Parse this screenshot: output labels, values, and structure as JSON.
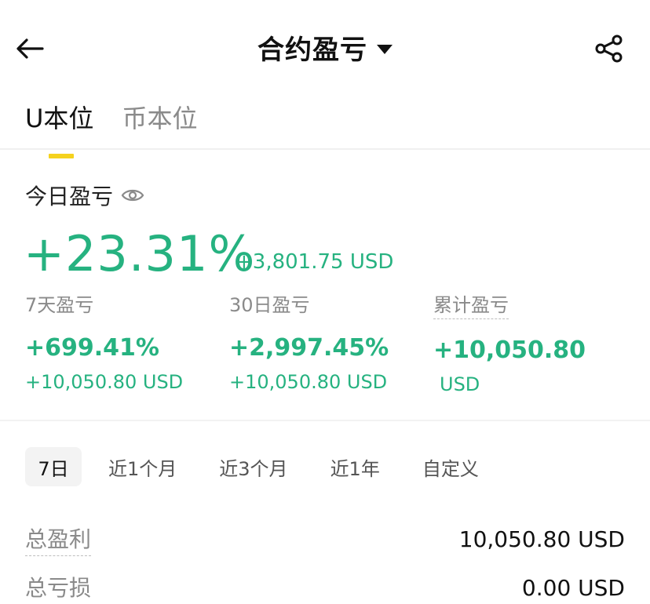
{
  "header": {
    "title": "合约盈亏",
    "back_icon": "arrow-left-icon",
    "dropdown_icon": "caret-down-icon",
    "share_icon": "share-icon"
  },
  "tabs": [
    {
      "label": "U本位",
      "active": true
    },
    {
      "label": "币本位",
      "active": false
    }
  ],
  "today": {
    "label": "今日盈亏",
    "eye_icon": "eye-icon",
    "pct": "+23.31%",
    "usd": "+3,801.75 USD"
  },
  "stats": [
    {
      "label": "7天盈亏",
      "value": "+699.41%",
      "sub": "+10,050.80 USD"
    },
    {
      "label": "30日盈亏",
      "value": "+2,997.45%",
      "sub": "+10,050.80 USD"
    },
    {
      "label": "累计盈亏",
      "value": "+10,050.80",
      "sub": "USD"
    }
  ],
  "ranges": [
    {
      "label": "7日",
      "active": true
    },
    {
      "label": "近1个月",
      "active": false
    },
    {
      "label": "近3个月",
      "active": false
    },
    {
      "label": "近1年",
      "active": false
    },
    {
      "label": "自定义",
      "active": false
    }
  ],
  "summary": [
    {
      "label": "总盈利",
      "value": "10,050.80 USD"
    },
    {
      "label": "总亏损",
      "value": "0.00 USD"
    }
  ],
  "colors": {
    "profit_green": "#26b280",
    "tab_indicator": "#f5d21e",
    "muted_text": "#8a8a8a"
  }
}
